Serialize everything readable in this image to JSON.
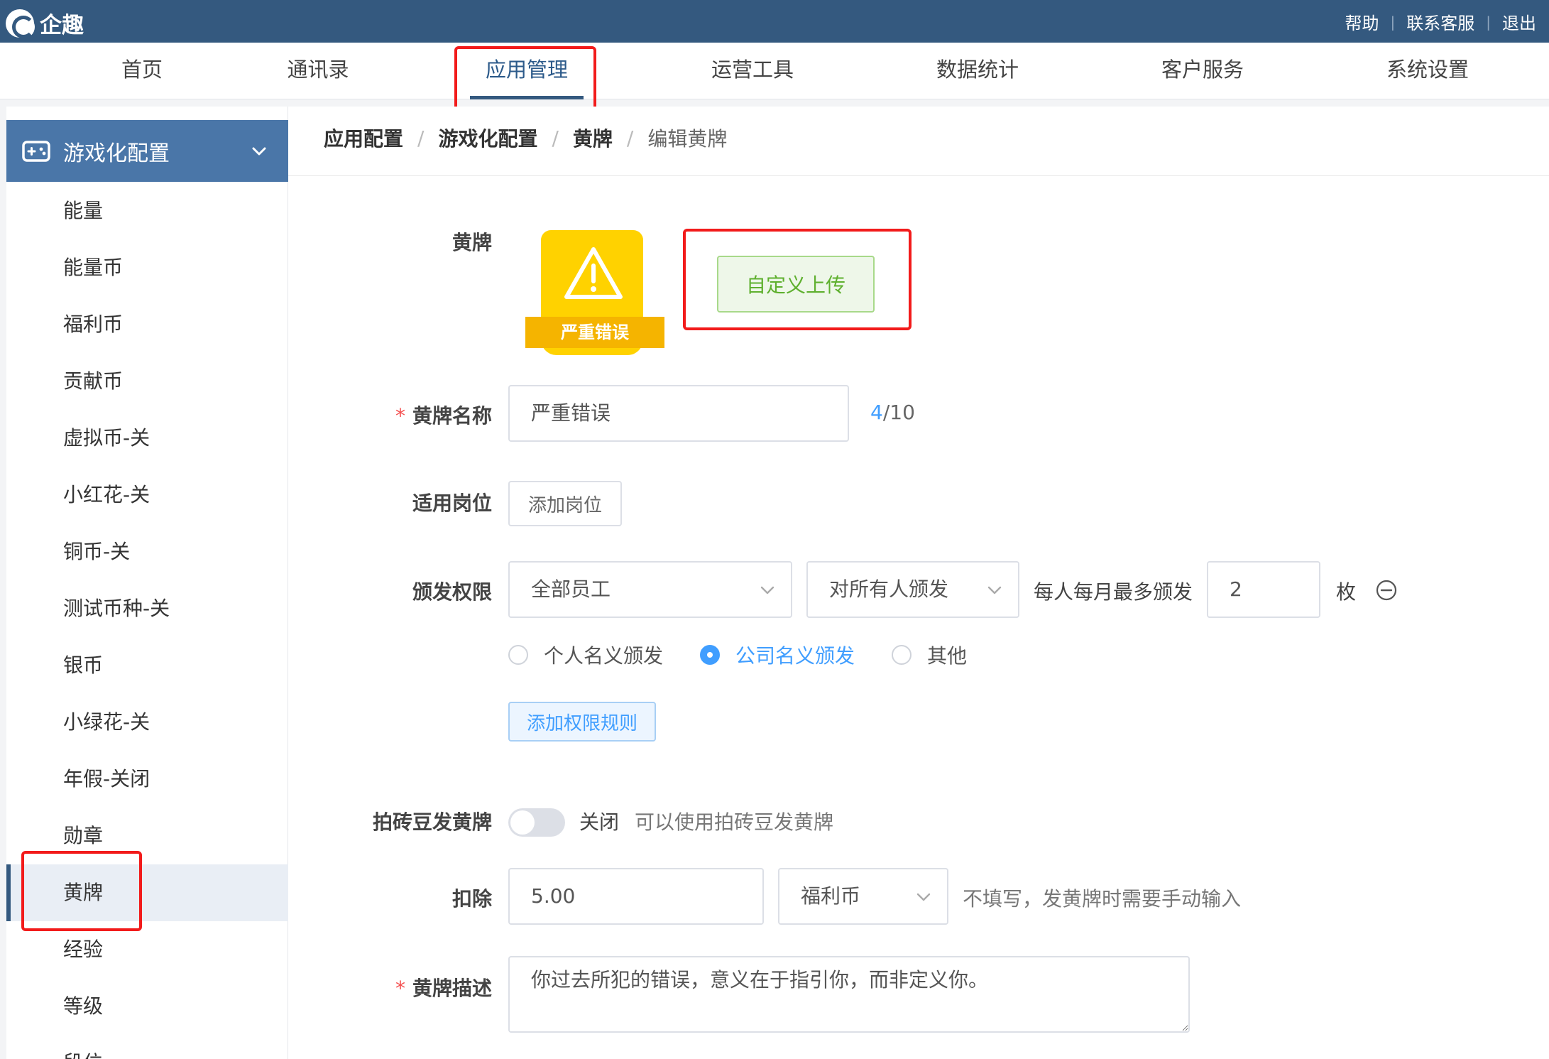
{
  "app": {
    "logo_text": "企趣"
  },
  "top_links": [
    "帮助",
    "联系客服",
    "退出"
  ],
  "nav": {
    "items": [
      "首页",
      "通讯录",
      "应用管理",
      "运营工具",
      "数据统计",
      "客户服务",
      "系统设置"
    ],
    "active": "应用管理"
  },
  "sidebar": {
    "group_label": "游戏化配置",
    "items": [
      "能量",
      "能量币",
      "福利币",
      "贡献币",
      "虚拟币-关",
      "小红花-关",
      "铜币-关",
      "测试币种-关",
      "银币",
      "小绿花-关",
      "年假-关闭",
      "勋章",
      "黄牌",
      "经验",
      "等级",
      "段位"
    ],
    "active": "黄牌"
  },
  "breadcrumb": [
    "应用配置",
    "游戏化配置",
    "黄牌",
    "编辑黄牌"
  ],
  "form": {
    "badge": {
      "label": "黄牌",
      "ribbon_text": "严重错误",
      "upload_label": "自定义上传"
    },
    "name": {
      "label": "黄牌名称",
      "value": "严重错误",
      "count_current": "4",
      "count_max": "/10"
    },
    "post": {
      "label": "适用岗位",
      "add_label": "添加岗位"
    },
    "permission": {
      "label": "颁发权限",
      "scope_value": "全部员工",
      "target_value": "对所有人颁发",
      "limit_label": "每人每月最多颁发",
      "limit_value": "2",
      "unit": "枚",
      "radios": [
        "个人名义颁发",
        "公司名义颁发",
        "其他"
      ],
      "selected_radio": "公司名义颁发",
      "add_rule_label": "添加权限规则"
    },
    "brick": {
      "label": "拍砖豆发黄牌",
      "switch_state": "关闭",
      "hint": "可以使用拍砖豆发黄牌",
      "enabled": false
    },
    "deduct": {
      "label": "扣除",
      "value": "5.00",
      "currency": "福利币",
      "hint": "不填写，发黄牌时需要手动输入"
    },
    "description": {
      "label": "黄牌描述",
      "value": "你过去所犯的错误，意义在于指引你，而非定义你。"
    }
  },
  "colors": {
    "topbar": "#34597f",
    "sidebar_head": "#4a76a8",
    "primary": "#409eff",
    "highlight": "#f21b1b",
    "badge_yellow": "#ffd200"
  }
}
